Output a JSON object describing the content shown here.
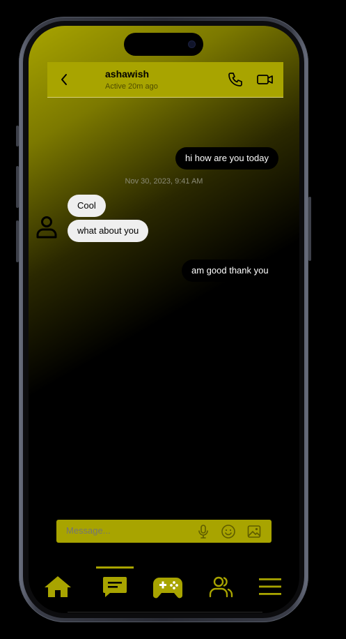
{
  "chat": {
    "contact_name": "ashawish",
    "status": "Active 20m ago"
  },
  "messages": [
    {
      "direction": "sent",
      "text": "hi how are you today"
    },
    {
      "timestamp": "Nov 30, 2023, 9:41 AM"
    },
    {
      "direction": "received",
      "text": "Cool"
    },
    {
      "direction": "received",
      "text": "what about you"
    },
    {
      "direction": "sent",
      "text": "am good thank you"
    }
  ],
  "composer": {
    "placeholder": "Message...",
    "icons": [
      "microphone-icon",
      "emoji-icon",
      "image-icon"
    ]
  },
  "nav": {
    "items": [
      "home-icon",
      "chat-icon",
      "gamepad-icon",
      "friends-icon",
      "menu-icon"
    ],
    "active": "chat-icon"
  },
  "colors": {
    "accent": "#a8a400",
    "sent_bubble": "#000000",
    "received_bubble": "#efefef",
    "background": "#000000"
  }
}
